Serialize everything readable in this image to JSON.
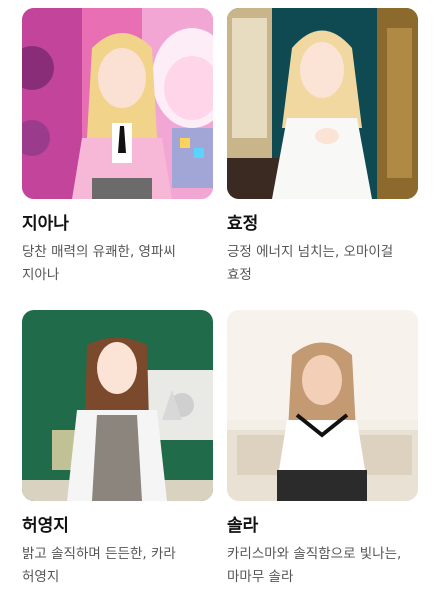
{
  "cards": [
    {
      "name": "지아나",
      "description": "당찬 매력의 유쾌한, 영파씨 지아나",
      "image_icon": "portrait-photo"
    },
    {
      "name": "효정",
      "description": "긍정 에너지 넘치는, 오마이걸 효정",
      "image_icon": "portrait-photo"
    },
    {
      "name": "허영지",
      "description": "밝고 솔직하며 든든한, 카라 허영지",
      "image_icon": "portrait-photo"
    },
    {
      "name": "솔라",
      "description": "카리스마와 솔직함으로 빛나는, 마마무 솔라",
      "image_icon": "portrait-photo"
    }
  ],
  "colors": {
    "name_text": "#111111",
    "desc_text": "#555555",
    "background": "#ffffff"
  }
}
